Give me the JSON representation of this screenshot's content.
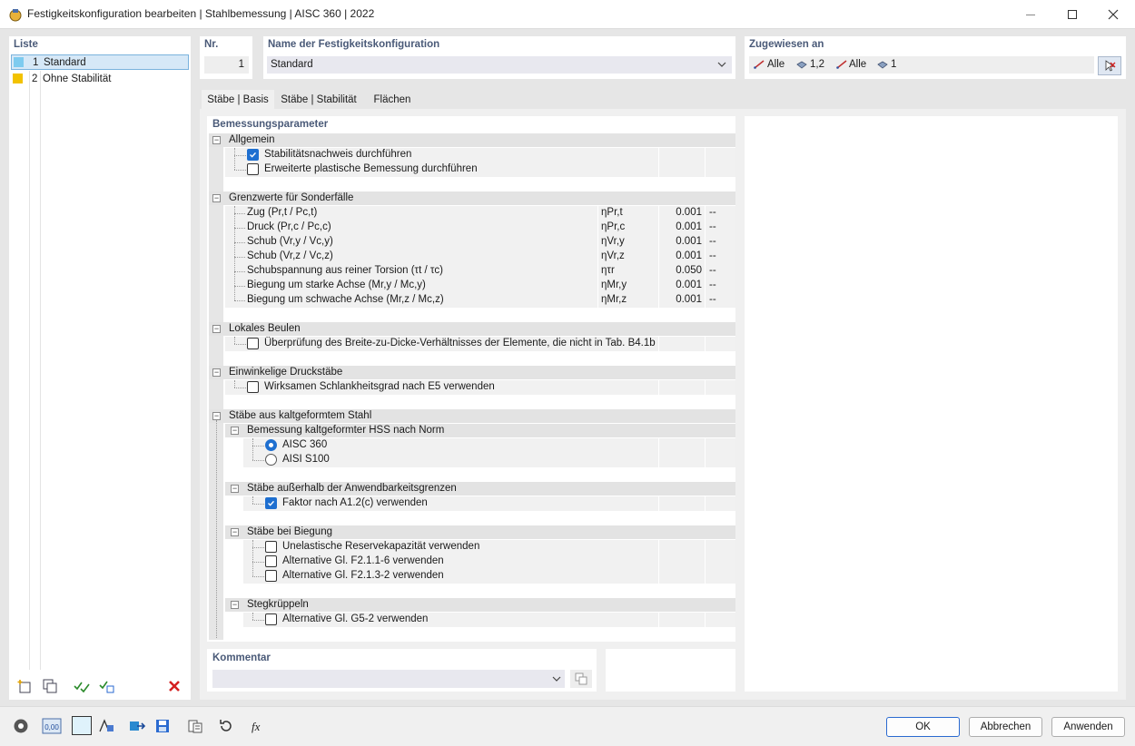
{
  "window": {
    "title": "Festigkeitskonfiguration bearbeiten | Stahlbemessung | AISC 360 | 2022"
  },
  "list": {
    "header": "Liste",
    "items": [
      {
        "no": "1",
        "label": "Standard",
        "color": "#7ecbef"
      },
      {
        "no": "2",
        "label": "Ohne Stabilität",
        "color": "#f2c200"
      }
    ]
  },
  "nr": {
    "header": "Nr.",
    "value": "1"
  },
  "name": {
    "header": "Name der Festigkeitskonfiguration",
    "value": "Standard"
  },
  "assigned": {
    "header": "Zugewiesen an",
    "items": [
      "Alle",
      "1,2",
      "Alle",
      "1"
    ]
  },
  "tabs": [
    "Stäbe | Basis",
    "Stäbe | Stabilität",
    "Flächen"
  ],
  "params": {
    "header": "Bemessungsparameter",
    "allgemein": {
      "title": "Allgemein",
      "stab": "Stabilitätsnachweis durchführen",
      "plast": "Erweiterte plastische Bemessung durchführen"
    },
    "grenz": {
      "title": "Grenzwerte für Sonderfälle",
      "rows": [
        {
          "label": "Zug (Pr,t / Pc,t)",
          "sym": "ηPr,t",
          "value": "0.001",
          "unit": "--"
        },
        {
          "label": "Druck (Pr,c / Pc,c)",
          "sym": "ηPr,c",
          "value": "0.001",
          "unit": "--"
        },
        {
          "label": "Schub (Vr,y / Vc,y)",
          "sym": "ηVr,y",
          "value": "0.001",
          "unit": "--"
        },
        {
          "label": "Schub (Vr,z / Vc,z)",
          "sym": "ηVr,z",
          "value": "0.001",
          "unit": "--"
        },
        {
          "label": "Schubspannung aus reiner Torsion (τt / τc)",
          "sym": "ητr",
          "value": "0.050",
          "unit": "--"
        },
        {
          "label": "Biegung um starke Achse (Mr,y / Mc,y)",
          "sym": "ηMr,y",
          "value": "0.001",
          "unit": "--"
        },
        {
          "label": "Biegung um schwache Achse (Mr,z / Mc,z)",
          "sym": "ηMr,z",
          "value": "0.001",
          "unit": "--"
        }
      ]
    },
    "beulen": {
      "title": "Lokales Beulen",
      "item": "Überprüfung des Breite-zu-Dicke-Verhältnisses der Elemente, die nicht in Tab. B4.1b"
    },
    "einw": {
      "title": "Einwinkelige Druckstäbe",
      "item": "Wirksamen Schlankheitsgrad nach E5 verwenden"
    },
    "kalt": {
      "title": "Stäbe aus kaltgeformtem Stahl",
      "hss": {
        "title": "Bemessung kaltgeformter HSS nach Norm",
        "opt1": "AISC 360",
        "opt2": "AISI S100"
      },
      "ausser": {
        "title": "Stäbe außerhalb der Anwendbarkeitsgrenzen",
        "item": "Faktor nach A1.2(c) verwenden"
      },
      "biegung": {
        "title": "Stäbe bei Biegung",
        "items": [
          "Unelastische Reservekapazität verwenden",
          "Alternative Gl. F2.1.1-6 verwenden",
          "Alternative Gl. F2.1.3-2 verwenden"
        ]
      },
      "steg": {
        "title": "Stegkrüppeln",
        "item": "Alternative Gl. G5-2 verwenden"
      }
    }
  },
  "comment": {
    "header": "Kommentar",
    "value": ""
  },
  "footer": {
    "ok": "OK",
    "cancel": "Abbrechen",
    "apply": "Anwenden",
    "decimals_icon_text": "0,00"
  },
  "colors": {
    "accent": "#1e6fd0",
    "header": "#4a5a78",
    "delete": "#d42020"
  }
}
